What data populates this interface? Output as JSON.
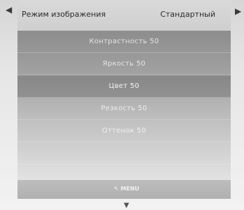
{
  "nav": {
    "left_arrow": "◀",
    "right_arrow": "▶",
    "down_arrow": "▼"
  },
  "header": {
    "label": "Режим изображения",
    "value": "Стандартный"
  },
  "menu": {
    "items": [
      {
        "label": "Контрастность 50"
      },
      {
        "label": "Яркость 50"
      },
      {
        "label": "Цвет 50"
      },
      {
        "label": "Резкость 50"
      },
      {
        "label": "Оттенок 50"
      },
      {
        "label": ""
      }
    ],
    "selected_index": 2
  },
  "footer": {
    "menu_label": "MENU",
    "menu_icon": "↖"
  }
}
